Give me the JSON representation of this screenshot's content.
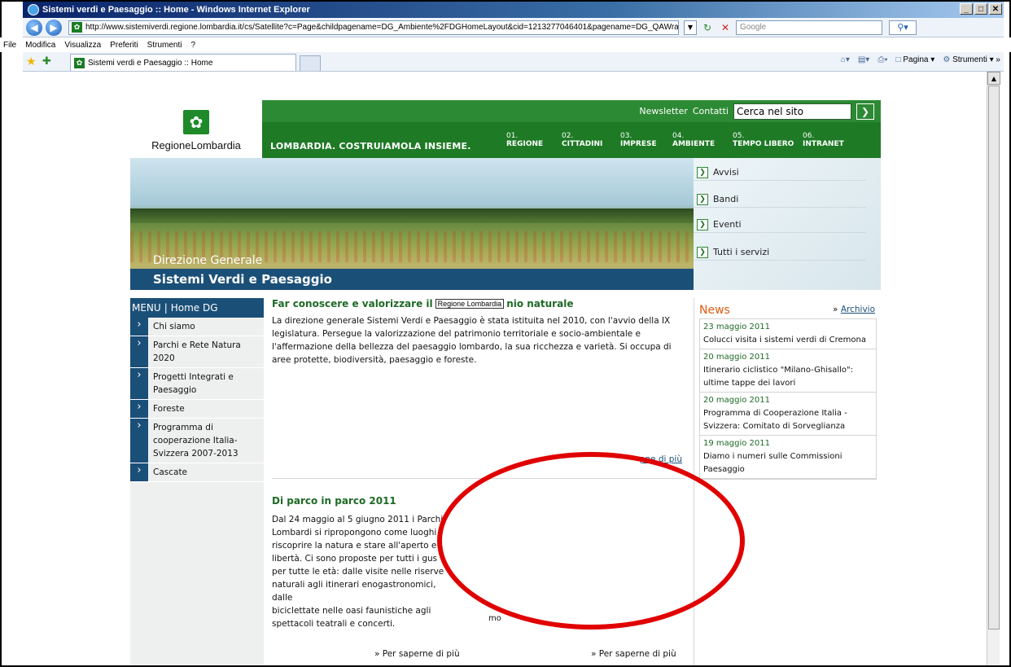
{
  "window": {
    "title": "Sistemi verdi e Paesaggio :: Home - Windows Internet Explorer",
    "controls": [
      "_",
      "□",
      "✕"
    ]
  },
  "address_bar": {
    "url": "http://www.sistemiverdi.regione.lombardia.it/cs/Satellite?c=Page&childpagename=DG_Ambiente%2FDGHomeLayout&cid=1213277046401&pagename=DG_QAWrapper",
    "search_placeholder": "Google"
  },
  "menubar": [
    "File",
    "Modifica",
    "Visualizza",
    "Preferiti",
    "Strumenti",
    "?"
  ],
  "tab": {
    "title": "Sistemi verdi e Paesaggio :: Home"
  },
  "toolbar": {
    "page_label": "Pagina",
    "tools_label": "Strumenti"
  },
  "site": {
    "logo_text": "RegioneLombardia",
    "top_links": [
      "Newsletter",
      "Contatti"
    ],
    "search_value": "Cerca nel sito",
    "slogan": "LOMBARDIA. COSTRUIAMOLA INSIEME.",
    "nav": [
      {
        "num": "01.",
        "label": "REGIONE"
      },
      {
        "num": "02.",
        "label": "CITTADINI"
      },
      {
        "num": "03.",
        "label": "IMPRESE"
      },
      {
        "num": "04.",
        "label": "AMBIENTE"
      },
      {
        "num": "05.",
        "label": "TEMPO LIBERO"
      },
      {
        "num": "06.",
        "label": "INTRANET"
      }
    ],
    "hero_subtitle": "Direzione Generale",
    "hero_title": "Sistemi Verdi e Paesaggio",
    "services": [
      "Avvisi",
      "Bandi",
      "Eventi",
      "Tutti i servizi"
    ]
  },
  "menu": {
    "head_menu": "MENU",
    "head_home": "Home DG",
    "items": [
      "Chi siamo",
      "Parchi e Rete Natura 2020",
      "Progetti Integrati e Paesaggio",
      "Foreste",
      "Programma di cooperazione Italia-Svizzera 2007-2013",
      "Cascate"
    ]
  },
  "article1": {
    "title_before": "Far conoscere e valorizzare il",
    "tooltip": "Regione Lombardia",
    "title_after": "nio naturale",
    "body": "La direzione generale Sistemi Verdi e Paesaggio è stata istituita nel 2010, con l'avvio della IX legislatura. Persegue la valorizzazione del patrimonio territoriale e socio-ambientale e l'affermazione della bellezza del paesaggio lombardo, la sua ricchezza e varietà. Si occupa di aree protette, biodiversità, paesaggio e foreste.",
    "more_visible": "pne di più"
  },
  "article2": {
    "title": "Di parco in parco 2011",
    "body_lines": [
      "Dal 24 maggio al 5 giugno 2011 i Parchi",
      "Lombardi si ripropongono come luoghi",
      "riscoprire la natura e stare all'aperto e",
      "libertà. Ci sono proposte per tutti i gus",
      "per tutte le età: dalle visite nelle riserve",
      "naturali agli itinerari enogastronomici, dalle",
      "biciclettate nelle oasi faunistiche agli",
      "spettacoli teatrali e concerti."
    ],
    "more_visible": "mo"
  },
  "bottom_links": [
    "» Per saperne di più",
    "» Per saperne di più"
  ],
  "news": {
    "title": "News",
    "archive_prefix": "»",
    "archive": "Archivio",
    "items": [
      {
        "date": "23 maggio 2011",
        "text": "Colucci visita i sistemi verdi di Cremona"
      },
      {
        "date": "20 maggio 2011",
        "text": "Itinerario ciclistico \"Milano-Ghisallo\": ultime tappe dei lavori"
      },
      {
        "date": "20 maggio 2011",
        "text": "Programma di Cooperazione Italia - Svizzera: Comitato di Sorveglianza"
      },
      {
        "date": "19 maggio 2011",
        "text": "Diamo i numeri sulle Commissioni Paesaggio"
      }
    ]
  },
  "colors": {
    "green": "#1e7a25",
    "blue": "#1a4f78",
    "orange": "#e05a10",
    "annotation": "#e00000"
  }
}
